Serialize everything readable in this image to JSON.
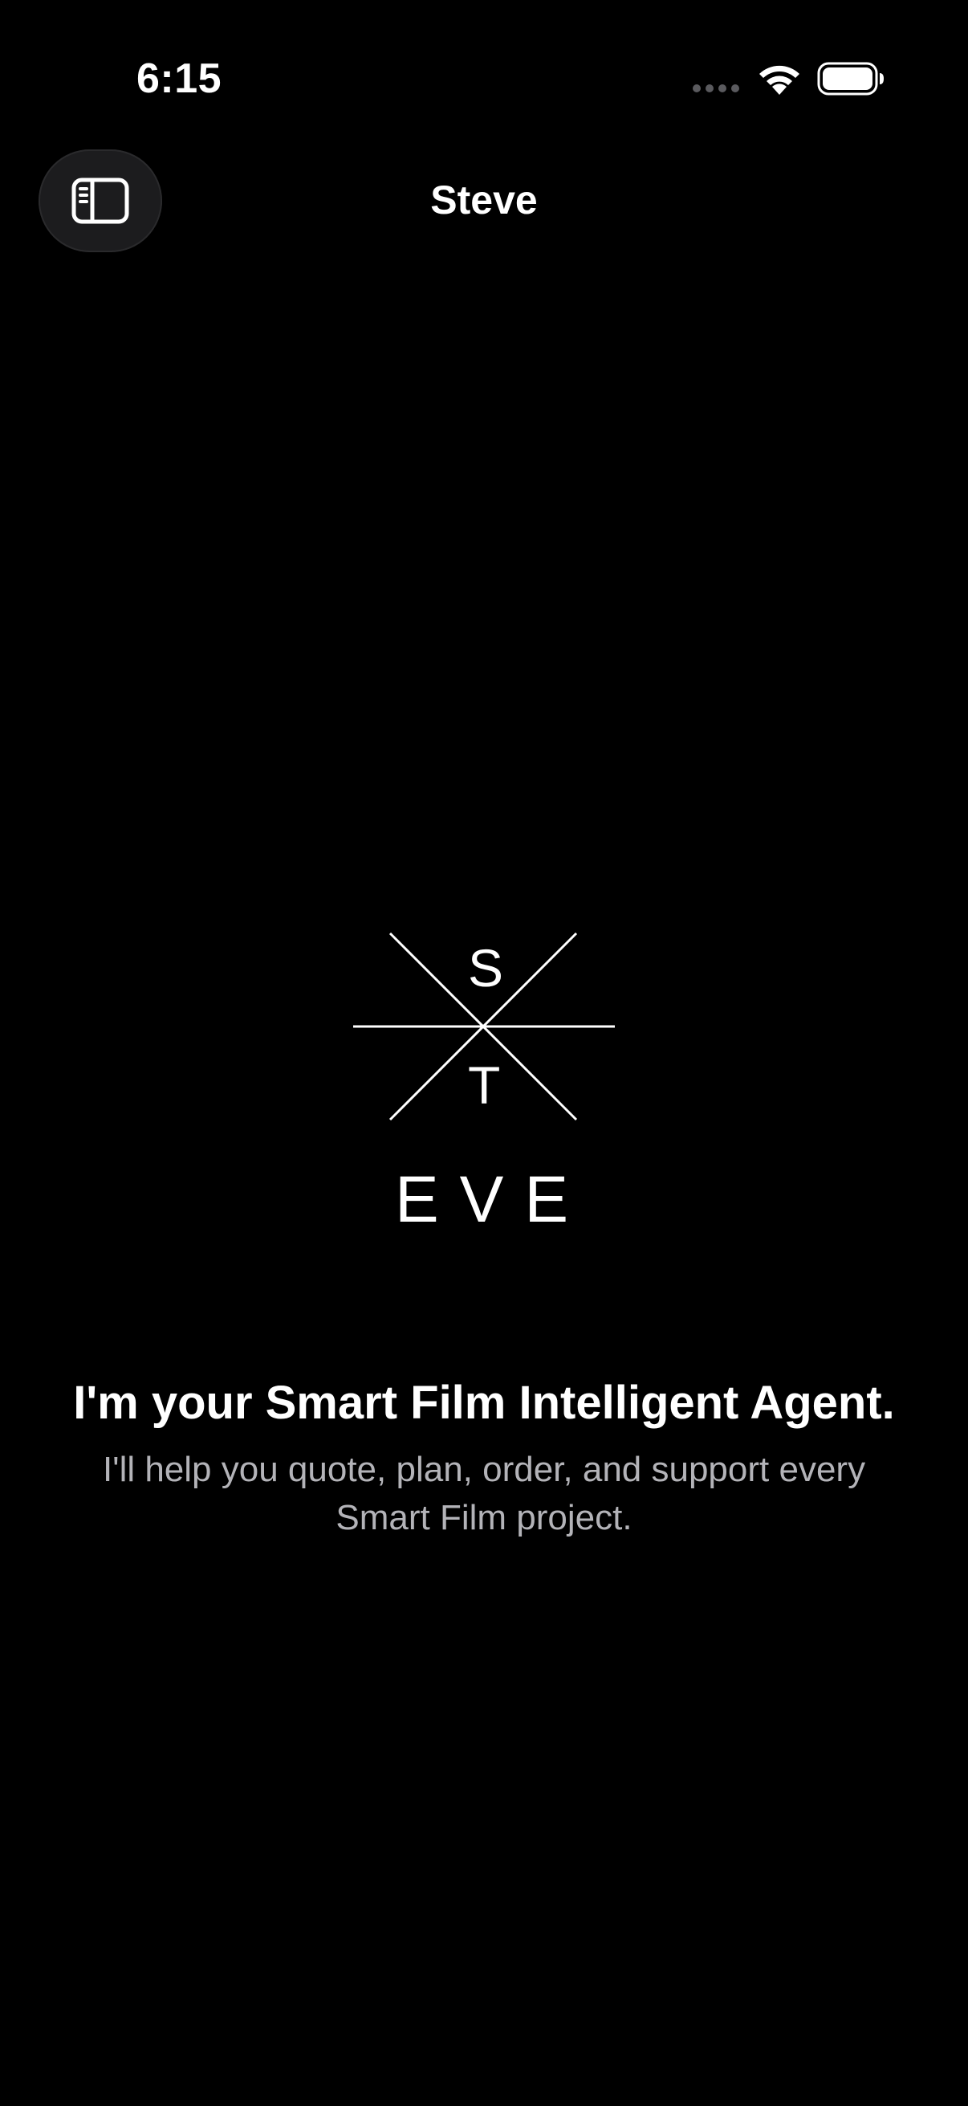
{
  "status_bar": {
    "time": "6:15",
    "icons": [
      "cellular-icon",
      "wifi-icon",
      "battery-icon"
    ]
  },
  "nav": {
    "title": "Steve",
    "sidebar_icon": "sidebar-icon"
  },
  "logo": {
    "top_letter": "S",
    "bottom_letter": "T",
    "wordmark": "EVE"
  },
  "intro": {
    "heading": "I'm your Smart Film Intelligent Agent.",
    "body": "I'll help you quote, plan, order, and support every Smart Film project."
  },
  "colors": {
    "background": "#000000",
    "text_primary": "#ffffff",
    "text_secondary": "#b3b3b8",
    "button_bg": "#1c1c1e"
  }
}
